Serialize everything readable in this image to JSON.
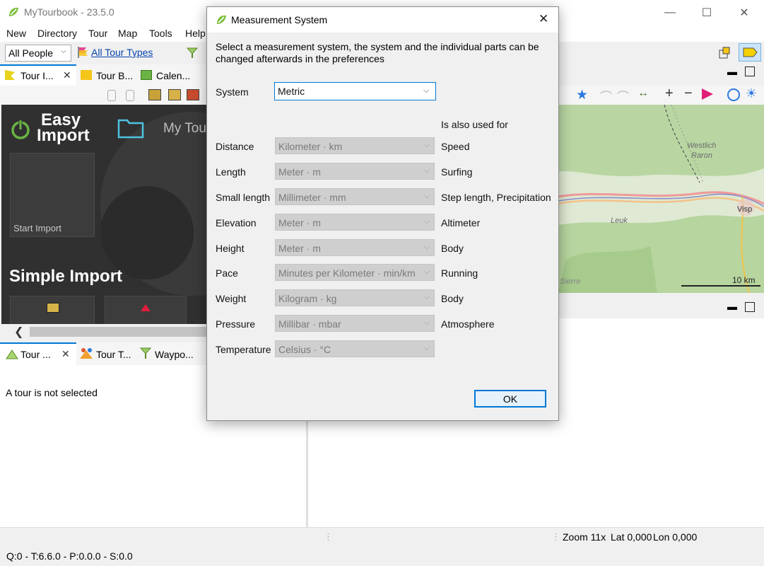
{
  "window": {
    "title": "MyTourbook - 23.5.0"
  },
  "menu": [
    "New",
    "Directory",
    "Tour",
    "Map",
    "Tools",
    "Help"
  ],
  "toolbar": {
    "people_value": "All People",
    "tour_types_link": "All Tour Types"
  },
  "top_tabs": [
    "Tour I...",
    "Tour B...",
    "Calen..."
  ],
  "easy_import": {
    "title_line1": "Easy",
    "title_line2": "Import",
    "my_tour_label": "My Tou",
    "start_import": "Start Import",
    "simple_import": "Simple Import"
  },
  "bottom_tabs": [
    "Tour ...",
    "Tour T...",
    "Waypo..."
  ],
  "tour_info": {
    "message": "A tour is not selected"
  },
  "map": {
    "labels": [
      "Westlich",
      "Raron",
      "Leuk",
      "Visp",
      "Sierre"
    ],
    "scale": "10 km"
  },
  "status": {
    "zoom": "Zoom 11x",
    "lat": "Lat 0,000",
    "lon": "Lon 0,000",
    "bottom": "Q:0 - T:6.6.0 - P:0.0.0 - S:0.0"
  },
  "dialog": {
    "title": "Measurement System",
    "description_line1": "Select a measurement system, the system and the individual parts can be",
    "description_line2": "changed afterwards in the preferences",
    "system_label": "System",
    "system_value": "Metric",
    "used_for_header": "Is also used for",
    "rows": [
      {
        "label": "Distance",
        "value": "Kilometer · km",
        "used_for": "Speed"
      },
      {
        "label": "Length",
        "value": "Meter · m",
        "used_for": "Surfing"
      },
      {
        "label": "Small length",
        "value": "Millimeter · mm",
        "used_for": "Step length, Precipitation"
      },
      {
        "label": "Elevation",
        "value": "Meter · m",
        "used_for": "Altimeter"
      },
      {
        "label": "Height",
        "value": "Meter · m",
        "used_for": "Body"
      },
      {
        "label": "Pace",
        "value": "Minutes per Kilometer · min/km",
        "used_for": "Running"
      },
      {
        "label": "Weight",
        "value": "Kilogram · kg",
        "used_for": "Body"
      },
      {
        "label": "Pressure",
        "value": "Millibar · mbar",
        "used_for": "Atmosphere"
      },
      {
        "label": "Temperature",
        "value": "Celsius · °C",
        "used_for": ""
      }
    ],
    "ok_label": "OK"
  },
  "colors": {
    "accent": "#0078d7",
    "panel_dark": "#303030",
    "easy_green": "#6ab344",
    "link": "#0645ad"
  }
}
